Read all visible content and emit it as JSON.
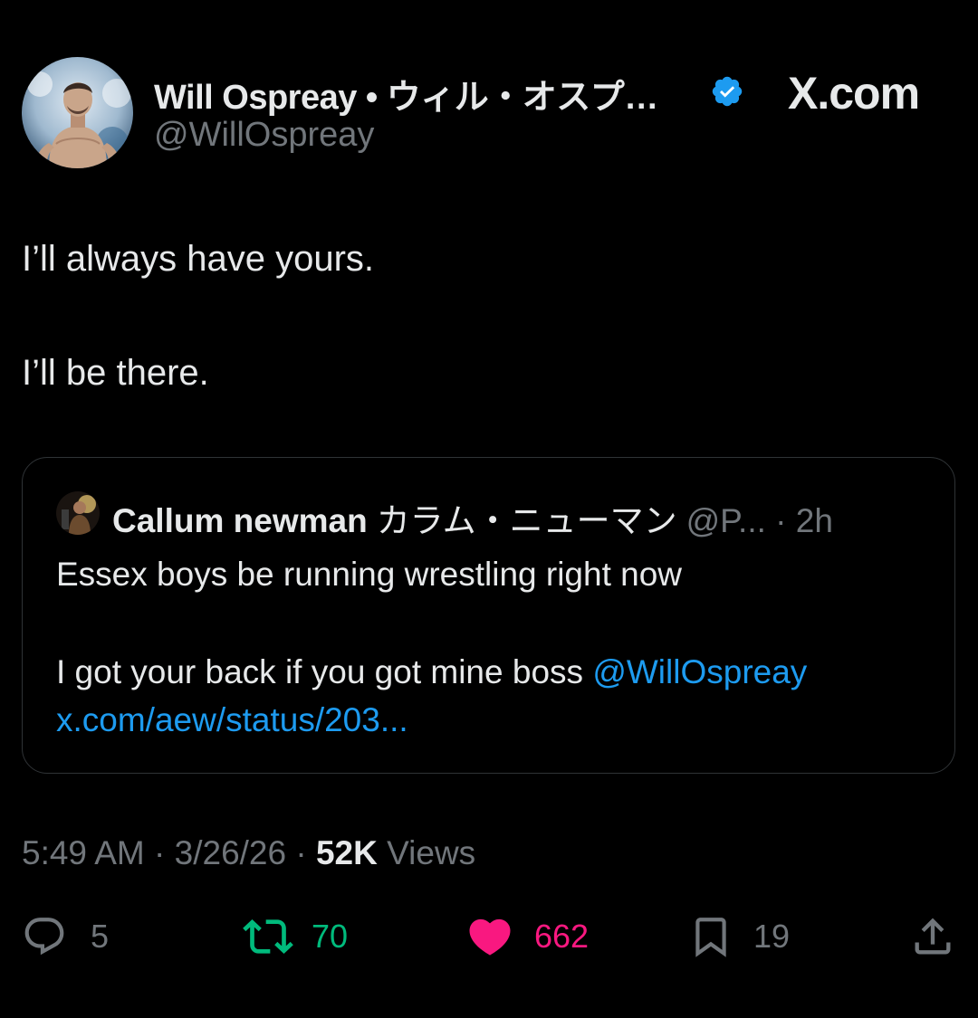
{
  "header": {
    "display_name": "Will Ospreay • ウィル・オスプ…",
    "handle": "@WillOspreay",
    "site_label": "X.com",
    "avatar_icon": "wrestler-avatar-icon",
    "verified_icon": "verified-badge-icon"
  },
  "tweet": {
    "lines": [
      "I’ll always have yours.",
      "I’ll be there."
    ]
  },
  "quote": {
    "name": "Callum newman",
    "name_jp": "カラム・ニューマン",
    "handle_time": "@P... · 2h",
    "line1": "Essex boys be running wrestling right now",
    "line2_text": "I got your back if you got mine boss ",
    "line2_mention": "@WillOspreay",
    "link": "x.com/aew/status/203..."
  },
  "meta": {
    "time_date": "5:49 AM · 3/26/26 · ",
    "views_count": "52K",
    "views_label": " Views"
  },
  "actions": {
    "replies": "5",
    "reposts": "70",
    "likes": "662",
    "bookmarks": "19"
  },
  "colors": {
    "background": "#000000",
    "text": "#e7e9ea",
    "secondary": "#71767b",
    "link": "#1d9bf0",
    "repost": "#00ba7c",
    "like": "#f91880",
    "border": "#2f3336"
  }
}
